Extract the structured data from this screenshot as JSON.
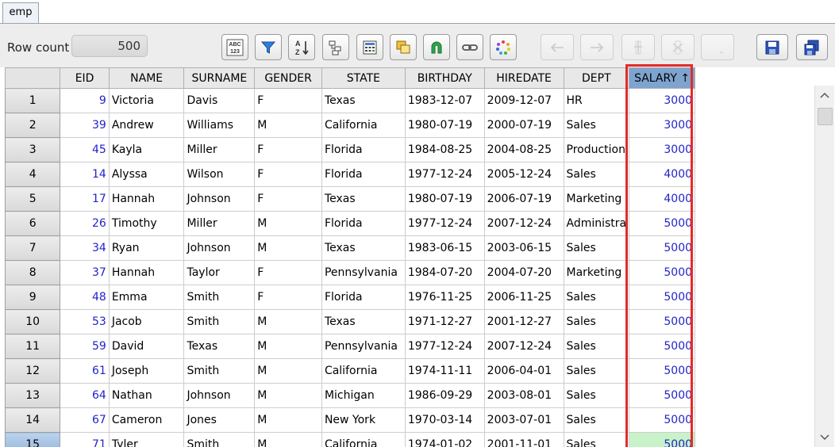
{
  "tab": {
    "label": "emp"
  },
  "toolbar": {
    "row_count_label": "Row count",
    "row_count_value": "500",
    "buttons": [
      {
        "name": "abc-123-icon",
        "enabled": true
      },
      {
        "name": "filter-icon",
        "enabled": true
      },
      {
        "name": "sort-az-icon",
        "enabled": true
      },
      {
        "name": "group-icon",
        "enabled": true
      },
      {
        "name": "calculator-icon",
        "enabled": true
      },
      {
        "name": "layers-icon",
        "enabled": true
      },
      {
        "name": "magnet-icon",
        "enabled": true
      },
      {
        "name": "link-icon",
        "enabled": true
      },
      {
        "name": "loading-icon",
        "enabled": true
      },
      {
        "name": "arrow-left-icon",
        "enabled": false
      },
      {
        "name": "arrow-right-icon",
        "enabled": false
      },
      {
        "name": "insert-column-icon",
        "enabled": false
      },
      {
        "name": "delete-column-icon",
        "enabled": false
      },
      {
        "name": "blank-icon",
        "enabled": false
      },
      {
        "name": "save-icon",
        "enabled": true
      },
      {
        "name": "save-all-icon",
        "enabled": true
      }
    ]
  },
  "table": {
    "columns": [
      "EID",
      "NAME",
      "SURNAME",
      "GENDER",
      "STATE",
      "BIRTHDAY",
      "HIREDATE",
      "DEPT",
      "SALARY ↑"
    ],
    "rows": [
      [
        "1",
        "9",
        "Victoria",
        "Davis",
        "F",
        "Texas",
        "1983-12-07",
        "2009-12-07",
        "HR",
        "3000"
      ],
      [
        "2",
        "39",
        "Andrew",
        "Williams",
        "M",
        "California",
        "1980-07-19",
        "2000-07-19",
        "Sales",
        "3000"
      ],
      [
        "3",
        "45",
        "Kayla",
        "Miller",
        "F",
        "Florida",
        "1984-08-25",
        "2004-08-25",
        "Production",
        "3000"
      ],
      [
        "4",
        "14",
        "Alyssa",
        "Wilson",
        "F",
        "Florida",
        "1977-12-24",
        "2005-12-24",
        "Sales",
        "4000"
      ],
      [
        "5",
        "17",
        "Hannah",
        "Johnson",
        "F",
        "Texas",
        "1980-07-19",
        "2006-07-19",
        "Marketing",
        "4000"
      ],
      [
        "6",
        "26",
        "Timothy",
        "Miller",
        "M",
        "Florida",
        "1977-12-24",
        "2007-12-24",
        "Administra",
        "5000"
      ],
      [
        "7",
        "34",
        "Ryan",
        "Johnson",
        "M",
        "Texas",
        "1983-06-15",
        "2003-06-15",
        "Sales",
        "5000"
      ],
      [
        "8",
        "37",
        "Hannah",
        "Taylor",
        "F",
        "Pennsylvania",
        "1984-07-20",
        "2004-07-20",
        "Marketing",
        "5000"
      ],
      [
        "9",
        "48",
        "Emma",
        "Smith",
        "F",
        "Florida",
        "1976-11-25",
        "2006-11-25",
        "Sales",
        "5000"
      ],
      [
        "10",
        "53",
        "Jacob",
        "Smith",
        "M",
        "Texas",
        "1971-12-27",
        "2001-12-27",
        "Sales",
        "5000"
      ],
      [
        "11",
        "59",
        "David",
        "Texas",
        "M",
        "Pennsylvania",
        "1977-12-24",
        "2007-12-24",
        "Sales",
        "5000"
      ],
      [
        "12",
        "61",
        "Joseph",
        "Smith",
        "M",
        "California",
        "1974-11-11",
        "2006-04-01",
        "Sales",
        "5000"
      ],
      [
        "13",
        "64",
        "Nathan",
        "Johnson",
        "M",
        "Michigan",
        "1986-09-29",
        "2003-08-01",
        "Sales",
        "5000"
      ],
      [
        "14",
        "67",
        "Cameron",
        "Jones",
        "M",
        "New York",
        "1970-03-14",
        "2003-07-01",
        "Sales",
        "5000"
      ],
      [
        "15",
        "71",
        "Tyler",
        "Smith",
        "M",
        "California",
        "1974-01-02",
        "2001-11-01",
        "Sales",
        "5000"
      ]
    ],
    "selected_row": 15,
    "highlight_color": "#e32b2b",
    "sorted_header_color": "#7ea3cf",
    "number_color": "#2323c8"
  }
}
